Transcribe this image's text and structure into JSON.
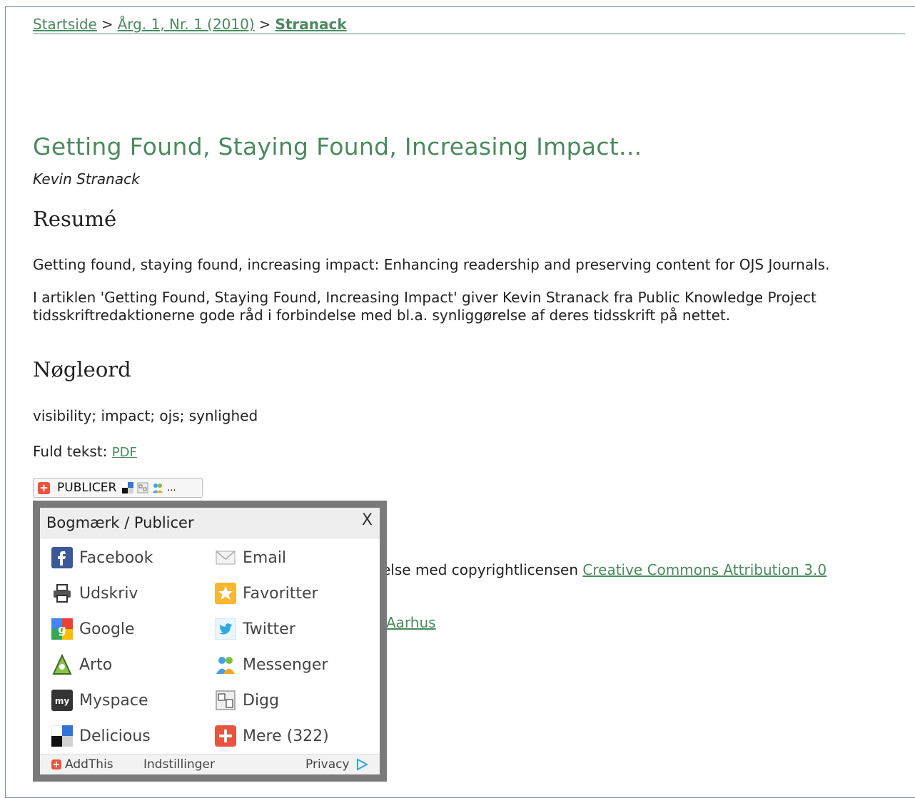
{
  "breadcrumb": {
    "home": "Startside",
    "sep1": ">",
    "issue": "Årg. 1, Nr. 1 (2010)",
    "sep2": ">",
    "current": "Stranack"
  },
  "article": {
    "title": "Getting Found, Staying Found, Increasing Impact...",
    "author": "Kevin Stranack",
    "abstract_heading": "Resumé",
    "abstract_p1": "Getting found, staying found, increasing impact: Enhancing readership and preserving content for OJS Journals.",
    "abstract_p2_line1": "I artiklen 'Getting Found, Staying Found, Increasing Impact' giver Kevin Stranack fra Public Knowledge Project",
    "abstract_p2_line2": "tidsskriftredaktionerne gode råd i forbindelse med bl.a. synliggørelse af deres tidsskrift på nettet.",
    "keywords_heading": "Nøgleord",
    "keywords": "visibility; impact; ojs; synlighed",
    "fulltext_label": "Fuld tekst:",
    "fulltext_link": "PDF",
    "license_text": "else med copyrightlicensen",
    "license_link": "Creative Commons Attribution 3.0",
    "publisher_link": "Aarhus"
  },
  "share": {
    "button_label": "PUBLICER",
    "ellipsis": "..."
  },
  "popup": {
    "title": "Bogmærk / Publicer",
    "close": "X",
    "left_column": [
      {
        "label": "Facebook",
        "icon": "facebook-icon"
      },
      {
        "label": "Udskriv",
        "icon": "printer-icon"
      },
      {
        "label": "Google",
        "icon": "google-icon"
      },
      {
        "label": "Arto",
        "icon": "arto-icon"
      },
      {
        "label": "Myspace",
        "icon": "myspace-icon"
      },
      {
        "label": "Delicious",
        "icon": "delicious-icon"
      }
    ],
    "right_column": [
      {
        "label": "Email",
        "icon": "email-icon"
      },
      {
        "label": "Favoritter",
        "icon": "star-icon"
      },
      {
        "label": "Twitter",
        "icon": "twitter-icon"
      },
      {
        "label": "Messenger",
        "icon": "messenger-icon"
      },
      {
        "label": "Digg",
        "icon": "digg-icon"
      },
      {
        "label": "Mere (322)",
        "icon": "plus-icon"
      }
    ],
    "footer": {
      "brand": "AddThis",
      "settings": "Indstillinger",
      "privacy": "Privacy"
    }
  },
  "colors": {
    "link_green": "#4a8a5e",
    "facebook": "#3b5998",
    "twitter": "#2fa9e0",
    "addthis": "#e8553e"
  }
}
